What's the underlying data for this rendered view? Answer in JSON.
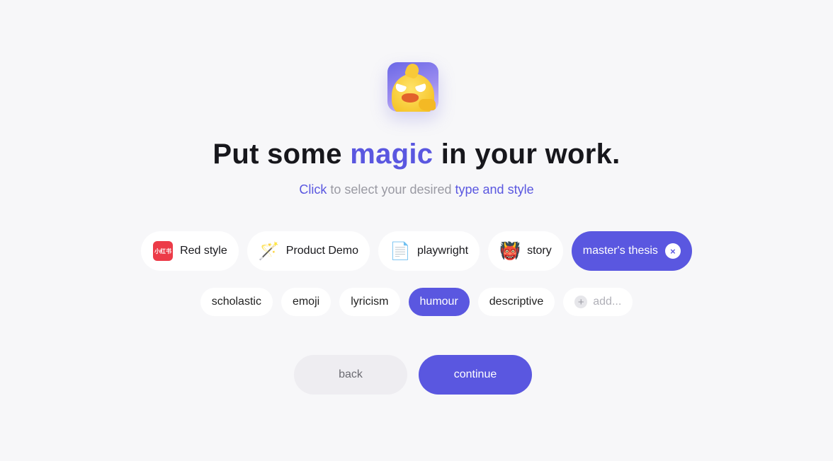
{
  "header": {
    "logo_icon": "angry-duck-logo",
    "title_before": "Put some ",
    "title_accent": "magic",
    "title_after": " in your work.",
    "subtitle": {
      "click": "Click",
      "middle": " to select your desired ",
      "type": "type",
      "and": " and ",
      "style": "style"
    }
  },
  "types": [
    {
      "label": "Red style",
      "icon": "redbook-icon",
      "icon_text": "小红书",
      "selected": false
    },
    {
      "label": "Product Demo",
      "icon": "magic-wand-icon",
      "glyph": "🪄",
      "selected": false
    },
    {
      "label": "playwright",
      "icon": "document-icon",
      "glyph": "📄",
      "selected": false
    },
    {
      "label": "story",
      "icon": "ogre-icon",
      "glyph": "👹",
      "selected": false
    },
    {
      "label": "master's thesis",
      "icon": "close-icon",
      "glyph": "×",
      "selected": true
    }
  ],
  "styles": [
    {
      "label": "scholastic",
      "selected": false
    },
    {
      "label": "emoji",
      "selected": false
    },
    {
      "label": "lyricism",
      "selected": false
    },
    {
      "label": "humour",
      "selected": true
    },
    {
      "label": "descriptive",
      "selected": false
    }
  ],
  "add_style": {
    "label": "add...",
    "icon": "plus-icon",
    "glyph": "+"
  },
  "actions": {
    "back": "back",
    "continue": "continue"
  },
  "colors": {
    "accent": "#5a57e0",
    "background": "#f7f7f9",
    "muted_text": "#9a9aa3"
  }
}
